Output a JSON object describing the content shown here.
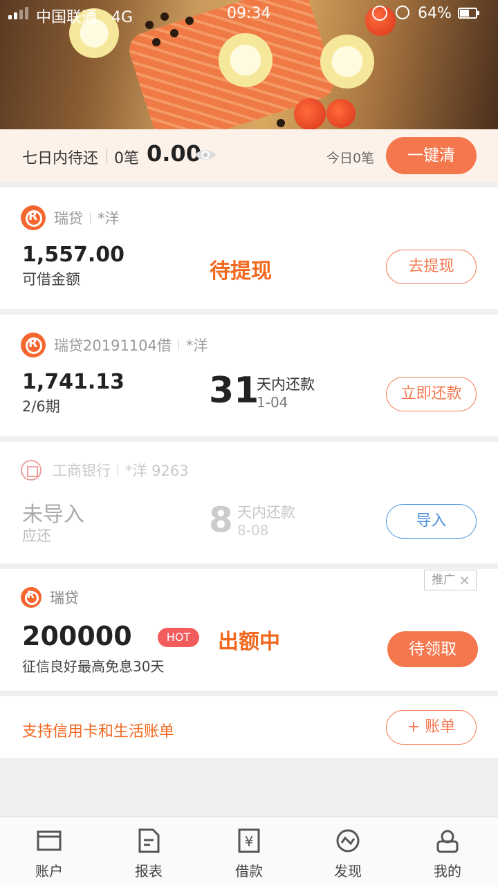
{
  "status_bar": {
    "carrier": "中国联通",
    "network": "4G",
    "time": "09:34",
    "battery_percent": "64%",
    "battery_level": 0.64,
    "signal_bars": 2
  },
  "summary": {
    "label": "七日内待还",
    "count": "0笔",
    "amount": "0.00",
    "today_label": "今日0笔",
    "clear_button": "一键清"
  },
  "cards": [
    {
      "brand": "瑞贷",
      "owner": "*洋",
      "amount": "1,557.00",
      "amount_label": "可借金额",
      "status": "待提现",
      "button": "去提现"
    },
    {
      "brand": "瑞贷20191104借",
      "owner": "*洋",
      "amount": "1,741.13",
      "period": "2/6期",
      "days": "31",
      "days_label": "天内还款",
      "due_date": "1-04",
      "button": "立即还款"
    },
    {
      "brand": "工商银行",
      "owner": "*洋 9263",
      "status": "未导入",
      "status_sub": "应还",
      "days": "8",
      "days_label": "天内还款",
      "due_date": "8-08",
      "button": "导入"
    },
    {
      "brand": "瑞贷",
      "ad_tag": "推广",
      "amount": "200000",
      "hot": "HOT",
      "status": "出额中",
      "desc": "征信良好最高免息30天",
      "button": "待领取"
    }
  ],
  "bill_support": {
    "text": "支持信用卡和生活账单",
    "button": "+ 账单"
  },
  "tabs": [
    {
      "label": "账户",
      "icon": "wallet-icon"
    },
    {
      "label": "报表",
      "icon": "report-icon"
    },
    {
      "label": "借款",
      "icon": "loan-icon"
    },
    {
      "label": "发现",
      "icon": "discover-icon"
    },
    {
      "label": "我的",
      "icon": "profile-icon"
    }
  ],
  "colors": {
    "accent": "#f5774d",
    "status_orange": "#f2681e",
    "import_blue": "#4a90e2",
    "hot_red": "#f25c5c"
  }
}
